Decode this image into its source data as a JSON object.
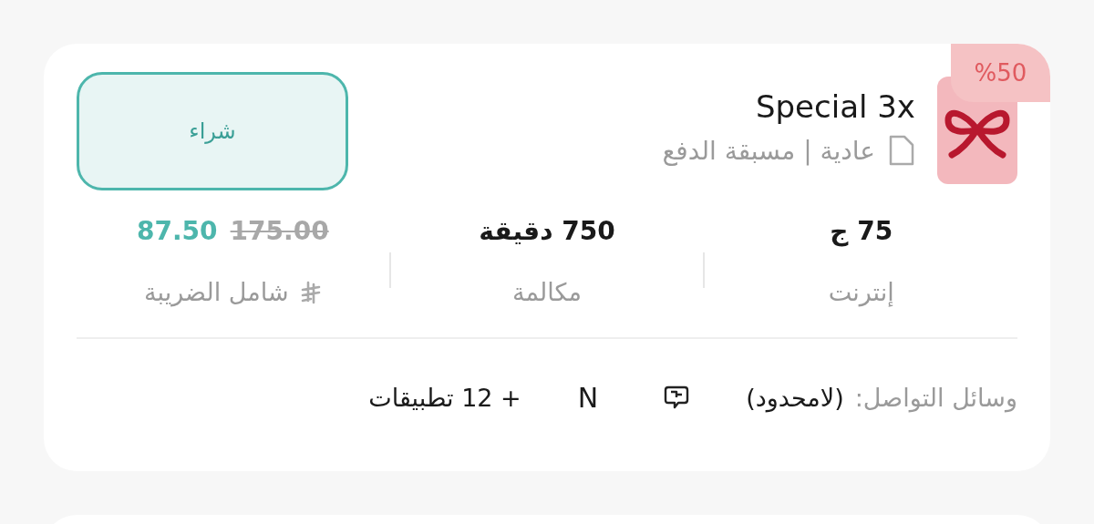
{
  "plan": {
    "title": "Special 3x",
    "discount_badge": "%50",
    "subtitle": "عادية | مسبقة الدفع",
    "buy_button": "شراء",
    "stats": [
      {
        "kind": "stat",
        "value": "75 ج",
        "label": "إنترنت"
      },
      {
        "kind": "stat",
        "value": "750 دقيقة",
        "label": "مكالمة"
      },
      {
        "kind": "price",
        "old_price": "175.00",
        "new_price": "87.50",
        "label": "شامل الضريبة"
      }
    ],
    "social": {
      "label": "وسائل التواصل:",
      "value": "(لامحدود)",
      "app_letter": "N",
      "more_apps": "+ 12 تطبيقات"
    }
  }
}
